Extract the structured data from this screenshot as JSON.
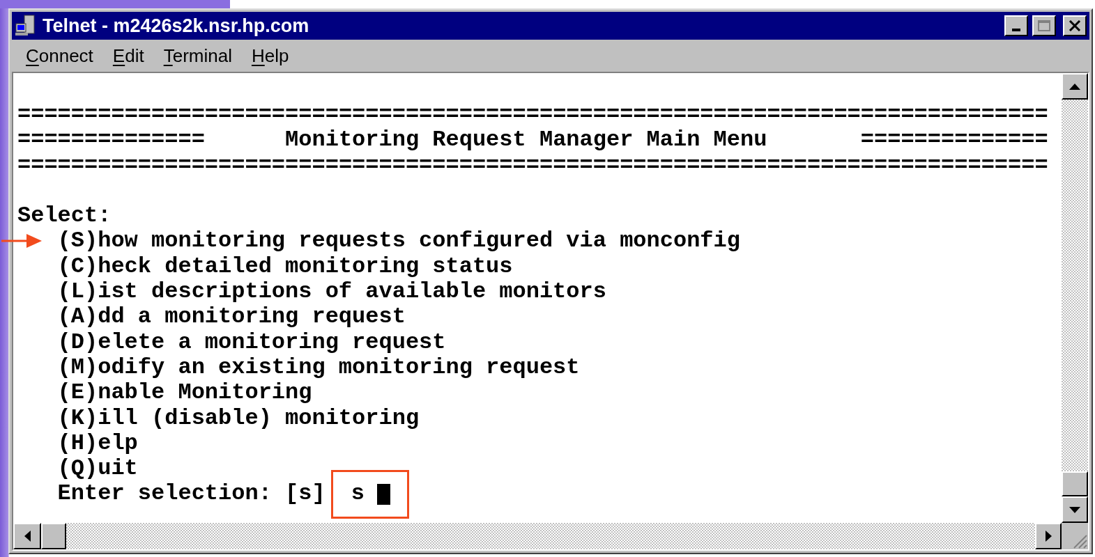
{
  "window": {
    "title": "Telnet - m2426s2k.nsr.hp.com"
  },
  "menu": [
    {
      "access_key": "C",
      "rest": "onnect"
    },
    {
      "access_key": "E",
      "rest": "dit"
    },
    {
      "access_key": "T",
      "rest": "erminal"
    },
    {
      "access_key": "H",
      "rest": "elp"
    }
  ],
  "terminal": {
    "lines": [
      {
        "kind": "text",
        "text": "=============================================================================",
        "marked": false
      },
      {
        "kind": "text",
        "text": "==============      Monitoring Request Manager Main Menu       ==============",
        "marked": false
      },
      {
        "kind": "text",
        "text": "=============================================================================",
        "marked": false
      },
      {
        "kind": "blank"
      },
      {
        "kind": "text",
        "text": "Select:",
        "marked": false,
        "children": [
          {
            "text": "(S)how monitoring requests configured via monconfig",
            "marked": true
          },
          {
            "text": "(C)heck detailed monitoring status",
            "marked": false
          },
          {
            "text": "(L)ist descriptions of available monitors",
            "marked": false
          },
          {
            "text": "(A)dd a monitoring request",
            "marked": false
          },
          {
            "text": "(D)elete a monitoring request",
            "marked": false
          },
          {
            "text": "(M)odify an existing monitoring request",
            "marked": false
          },
          {
            "text": "(E)nable Monitoring",
            "marked": false
          },
          {
            "text": "(K)ill (disable) monitoring",
            "marked": false
          },
          {
            "text": "(H)elp",
            "marked": false
          },
          {
            "text": "(Q)uit",
            "marked": false
          }
        ]
      }
    ],
    "input": {
      "prompt": "Enter selection: [s]",
      "value": "s",
      "highlighted": true,
      "cursor": true
    }
  }
}
